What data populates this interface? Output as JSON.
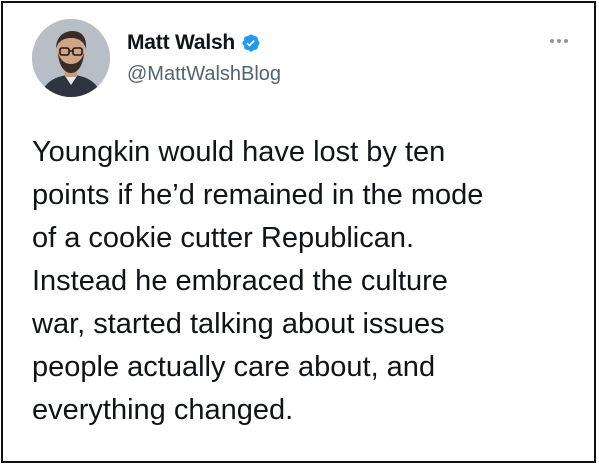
{
  "tweet": {
    "author_name": "Matt Walsh",
    "author_handle": "@MattWalshBlog",
    "verified": true,
    "text": "Youngkin would have lost by ten\npoints if he’d remained in the mode\nof a cookie cutter Republican.\nInstead he embraced the culture\nwar, started talking about issues\npeople actually care about, and\neverything changed."
  },
  "icons": {
    "verified": "verified-badge-icon",
    "more": "more-options-icon",
    "avatar": "profile-photo"
  },
  "colors": {
    "verified_blue": "#1d9bf0",
    "text_primary": "#0f1419",
    "text_secondary": "#536471",
    "border": "#111111"
  }
}
